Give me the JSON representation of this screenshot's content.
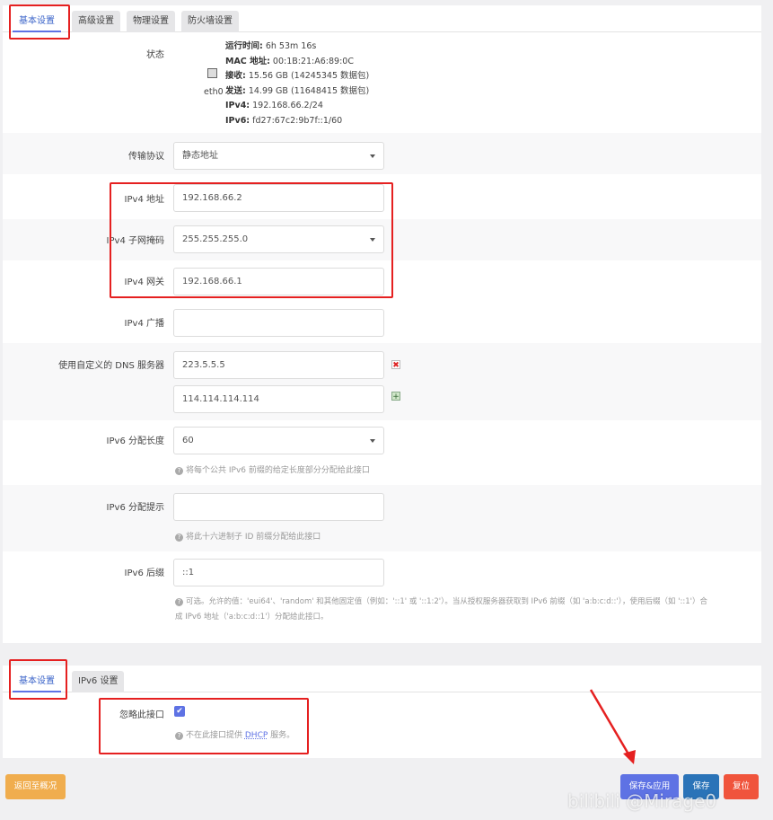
{
  "top_tabs": [
    "基本设置",
    "高级设置",
    "物理设置",
    "防火墙设置"
  ],
  "status": {
    "label": "状态",
    "iface": "eth0",
    "uptime_label": "运行时间:",
    "uptime": "6h 53m 16s",
    "mac_label": "MAC 地址:",
    "mac": "00:1B:21:A6:89:0C",
    "rx_label": "接收:",
    "rx": "15.56 GB (14245345 数据包)",
    "tx_label": "发送:",
    "tx": "14.99 GB (11648415 数据包)",
    "ipv4_label": "IPv4:",
    "ipv4": "192.168.66.2/24",
    "ipv6_label": "IPv6:",
    "ipv6": "fd27:67c2:9b7f::1/60"
  },
  "form": {
    "protocol_label": "传输协议",
    "protocol_value": "静态地址",
    "ipv4_addr_label": "IPv4 地址",
    "ipv4_addr_value": "192.168.66.2",
    "netmask_label": "IPv4 子网掩码",
    "netmask_value": "255.255.255.0",
    "gateway_label": "IPv4 网关",
    "gateway_value": "192.168.66.1",
    "broadcast_label": "IPv4 广播",
    "broadcast_value": "",
    "dns_label": "使用自定义的 DNS 服务器",
    "dns1": "223.5.5.5",
    "dns2": "114.114.114.114",
    "ip6assign_label": "IPv6 分配长度",
    "ip6assign_value": "60",
    "ip6assign_hint": "将每个公共 IPv6 前缀的给定长度部分分配给此接口",
    "ip6hint_label": "IPv6 分配提示",
    "ip6hint_value": "",
    "ip6hint_hint": "将此十六进制子 ID 前缀分配给此接口",
    "ip6suffix_label": "IPv6 后缀",
    "ip6suffix_value": "::1",
    "ip6suffix_hint1": "可选。允许的值：'eui64'、'random' 和其他固定值（例如：'::1' 或 '::1:2'）。当从授权服务器获取到 IPv6 前缀（如 'a:b:c:d::'），使用后缀（如 '::1'）合",
    "ip6suffix_hint2": "成 IPv6 地址（'a:b:c:d::1'）分配给此接口。"
  },
  "dhcp_tabs": [
    "基本设置",
    "IPv6 设置"
  ],
  "dhcp": {
    "ignore_label": "忽略此接口",
    "ignore_hint_pre": "不在此接口提供 ",
    "ignore_hint_link": "DHCP",
    "ignore_hint_post": " 服务。"
  },
  "buttons": {
    "back": "返回至概况",
    "save_apply": "保存&应用",
    "save": "保存",
    "reset": "复位"
  },
  "watermark": "bilibili @Mirage0",
  "colors": {
    "accent": "#5e72e4",
    "annotation_red": "#e52020",
    "back_btn": "#f0ad4e",
    "save_btn": "#2a73b8",
    "reset_btn": "#f0543c"
  }
}
